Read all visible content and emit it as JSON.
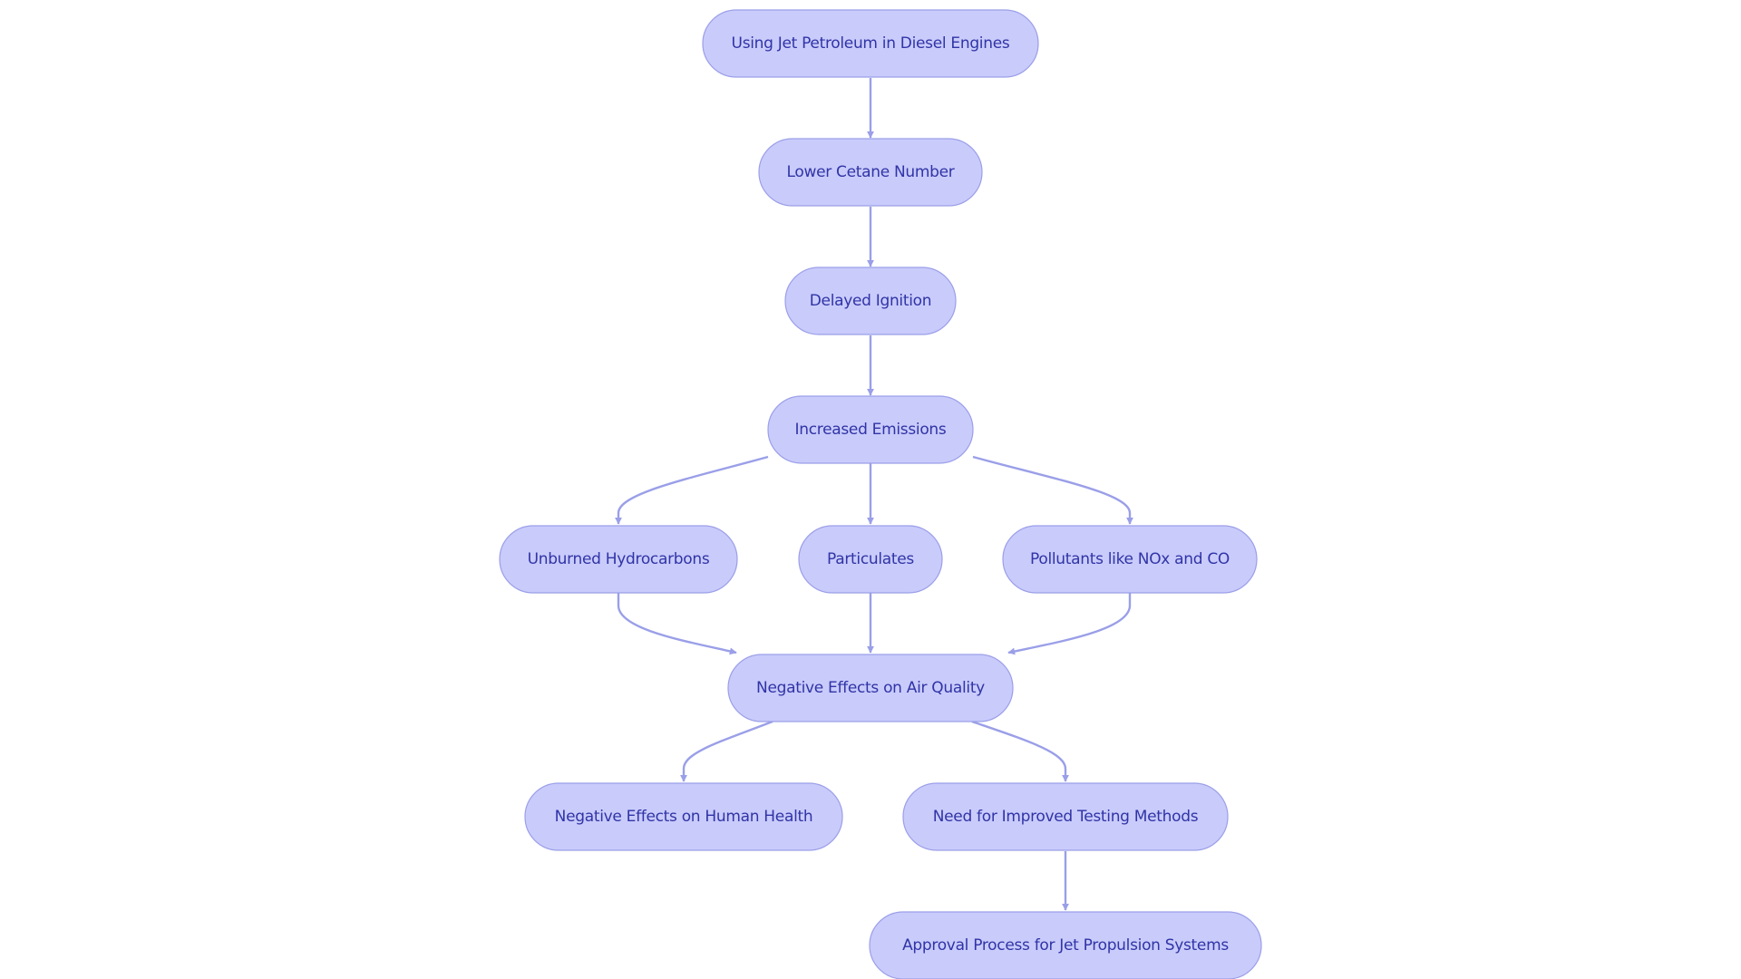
{
  "diagram": {
    "type": "flowchart",
    "colors": {
      "node_fill": "#c9cbfb",
      "node_stroke": "#9b9fe8",
      "node_text": "#3034a6",
      "edge": "#9a9fe8"
    },
    "nodes": [
      {
        "id": "A",
        "label": "Using Jet Petroleum in Diesel Engines"
      },
      {
        "id": "B",
        "label": "Lower Cetane Number"
      },
      {
        "id": "C",
        "label": "Delayed Ignition"
      },
      {
        "id": "D",
        "label": "Increased Emissions"
      },
      {
        "id": "E",
        "label": "Unburned Hydrocarbons"
      },
      {
        "id": "F",
        "label": "Particulates"
      },
      {
        "id": "G",
        "label": "Pollutants like NOx and CO"
      },
      {
        "id": "H",
        "label": "Negative Effects on Air Quality"
      },
      {
        "id": "I",
        "label": "Negative Effects on Human Health"
      },
      {
        "id": "J",
        "label": "Need for Improved Testing Methods"
      },
      {
        "id": "K",
        "label": "Approval Process for Jet Propulsion Systems"
      }
    ],
    "edges": [
      {
        "from": "A",
        "to": "B"
      },
      {
        "from": "B",
        "to": "C"
      },
      {
        "from": "C",
        "to": "D"
      },
      {
        "from": "D",
        "to": "E"
      },
      {
        "from": "D",
        "to": "F"
      },
      {
        "from": "D",
        "to": "G"
      },
      {
        "from": "E",
        "to": "H"
      },
      {
        "from": "F",
        "to": "H"
      },
      {
        "from": "G",
        "to": "H"
      },
      {
        "from": "H",
        "to": "I"
      },
      {
        "from": "H",
        "to": "J"
      },
      {
        "from": "J",
        "to": "K"
      }
    ]
  }
}
